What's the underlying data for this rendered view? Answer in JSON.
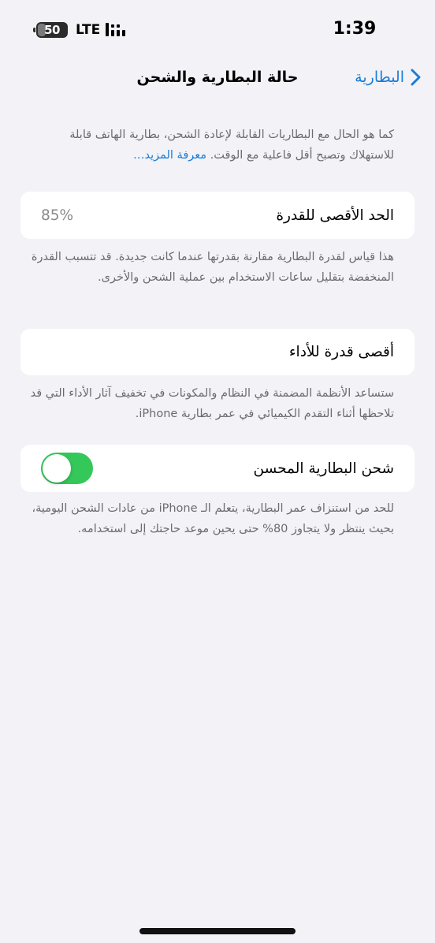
{
  "status_bar": {
    "battery_level": "50",
    "network": "LTE",
    "time": "1:39",
    "icons": [
      "battery-icon",
      "signal-icon"
    ]
  },
  "nav": {
    "back_label": "البطارية",
    "title": "حالة البطارية والشحن",
    "icons": [
      "chevron-back-icon"
    ]
  },
  "intro": {
    "text": "كما هو الحال مع البطاريات القابلة لإعادة الشحن، بطارية الهاتف قابلة للاستهلاك وتصبح أقل فاعلية مع الوقت.",
    "link": "معرفة المزيد…"
  },
  "max_capacity": {
    "label": "الحد الأقصى للقدرة",
    "value": "85%",
    "note": "هذا قياس لقدرة البطارية مقارنة بقدرتها عندما كانت جديدة. قد تتسبب القدرة المنخفضة بتقليل ساعات الاستخدام بين عملية الشحن والأخرى."
  },
  "peak_performance": {
    "label": "أقصى قدرة للأداء",
    "note": "ستساعد الأنظمة المضمنة في النظام والمكونات في تخفيف آثار الأداء التي قد تلاحظها أثناء التقدم الكيميائي في عمر بطارية iPhone."
  },
  "optimized_charging": {
    "label": "شحن البطارية المحسن",
    "enabled": true,
    "note": "للحد من استنزاف عمر البطارية، يتعلم الـ iPhone من عادات الشحن اليومية، بحيث ينتظر ولا يتجاوز 80% حتى يحين موعد حاجتك إلى استخدامه."
  },
  "colors": {
    "background": "#f2f2f7",
    "accent": "#1a7cd6",
    "toggle_on": "#34c759",
    "secondary_text": "#6b6b70"
  }
}
